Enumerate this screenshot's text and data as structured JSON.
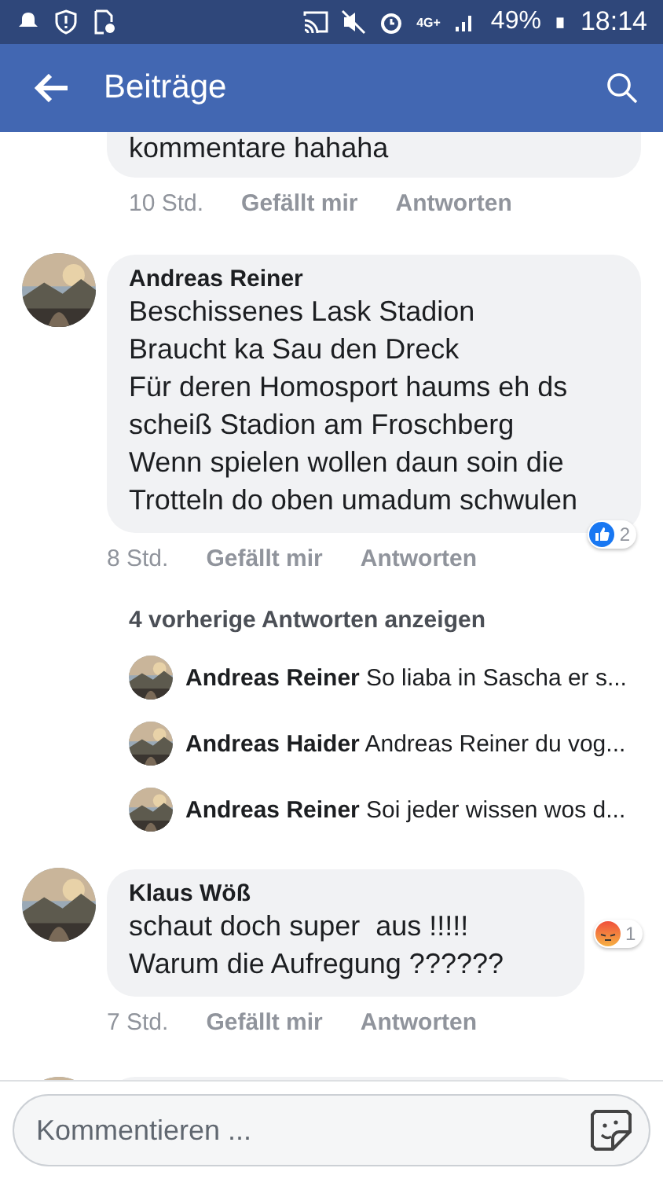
{
  "status_bar": {
    "network": "4G+",
    "battery": "49%",
    "time": "18:14"
  },
  "header": {
    "title": "Beiträge"
  },
  "top_comment": {
    "text": "kommentare hahaha",
    "time": "10 Std.",
    "like": "Gefällt mir",
    "reply": "Antworten"
  },
  "comments": [
    {
      "author": "Andreas Reiner",
      "lines": [
        "Beschissenes Lask Stadion",
        "Braucht ka Sau den Dreck",
        "Für deren Homosport haums eh ds",
        "scheiß Stadion am Froschberg",
        "Wenn spielen wollen daun soin die",
        "Trotteln do oben umadum schwulen"
      ],
      "time": "8 Std.",
      "like": "Gefällt mir",
      "reply": "Antworten",
      "reaction": {
        "kind": "like",
        "count": "2"
      },
      "more_replies": "4 vorherige Antworten anzeigen",
      "replies": [
        {
          "author": "Andreas Reiner",
          "text": "So liaba in Sascha er s..."
        },
        {
          "author": "Andreas Haider",
          "text": "Andreas Reiner du vog..."
        },
        {
          "author": "Andreas Reiner",
          "text": "Soi jeder wissen wos d..."
        }
      ]
    },
    {
      "author": "Klaus Wöß",
      "lines": [
        "schaut doch super  aus !!!!!",
        "Warum die Aufregung ??????"
      ],
      "time": "7 Std.",
      "like": "Gefällt mir",
      "reply": "Antworten",
      "reaction": {
        "kind": "angry",
        "count": "1"
      }
    }
  ],
  "composer": {
    "placeholder": "Kommentieren ..."
  }
}
